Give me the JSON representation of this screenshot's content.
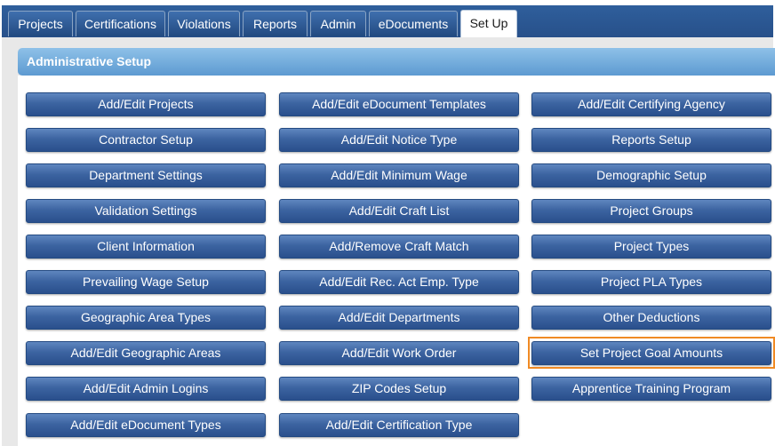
{
  "tabs": [
    {
      "label": "Projects",
      "active": false
    },
    {
      "label": "Certifications",
      "active": false
    },
    {
      "label": "Violations",
      "active": false
    },
    {
      "label": "Reports",
      "active": false
    },
    {
      "label": "Admin",
      "active": false
    },
    {
      "label": "eDocuments",
      "active": false
    },
    {
      "label": "Set Up",
      "active": true
    }
  ],
  "section": {
    "title": "Administrative Setup"
  },
  "buttons": {
    "col1": [
      "Add/Edit Projects",
      "Contractor Setup",
      "Department Settings",
      "Validation Settings",
      "Client Information",
      "Prevailing Wage Setup",
      "Geographic Area Types",
      "Add/Edit Geographic Areas",
      "Add/Edit Admin Logins",
      "Add/Edit eDocument Types"
    ],
    "col2": [
      "Add/Edit eDocument Templates",
      "Add/Edit Notice Type",
      "Add/Edit Minimum Wage",
      "Add/Edit Craft List",
      "Add/Remove Craft Match",
      "Add/Edit Rec. Act Emp. Type",
      "Add/Edit Departments",
      "Add/Edit Work Order",
      "ZIP Codes Setup",
      "Add/Edit Certification Type"
    ],
    "col3": [
      "Add/Edit Certifying Agency",
      "Reports Setup",
      "Demographic Setup",
      "Project Groups",
      "Project Types",
      "Project PLA Types",
      "Other Deductions",
      "Set Project Goal Amounts",
      "Apprentice Training Program"
    ]
  },
  "highlighted_button": "Set Project Goal Amounts",
  "colors": {
    "tab_strip": "#2f5f9c",
    "header_gradient_top": "#8ec1e8",
    "header_gradient_bottom": "#5d9ad1",
    "button": "#3c64a1",
    "highlight": "#f08a24"
  }
}
